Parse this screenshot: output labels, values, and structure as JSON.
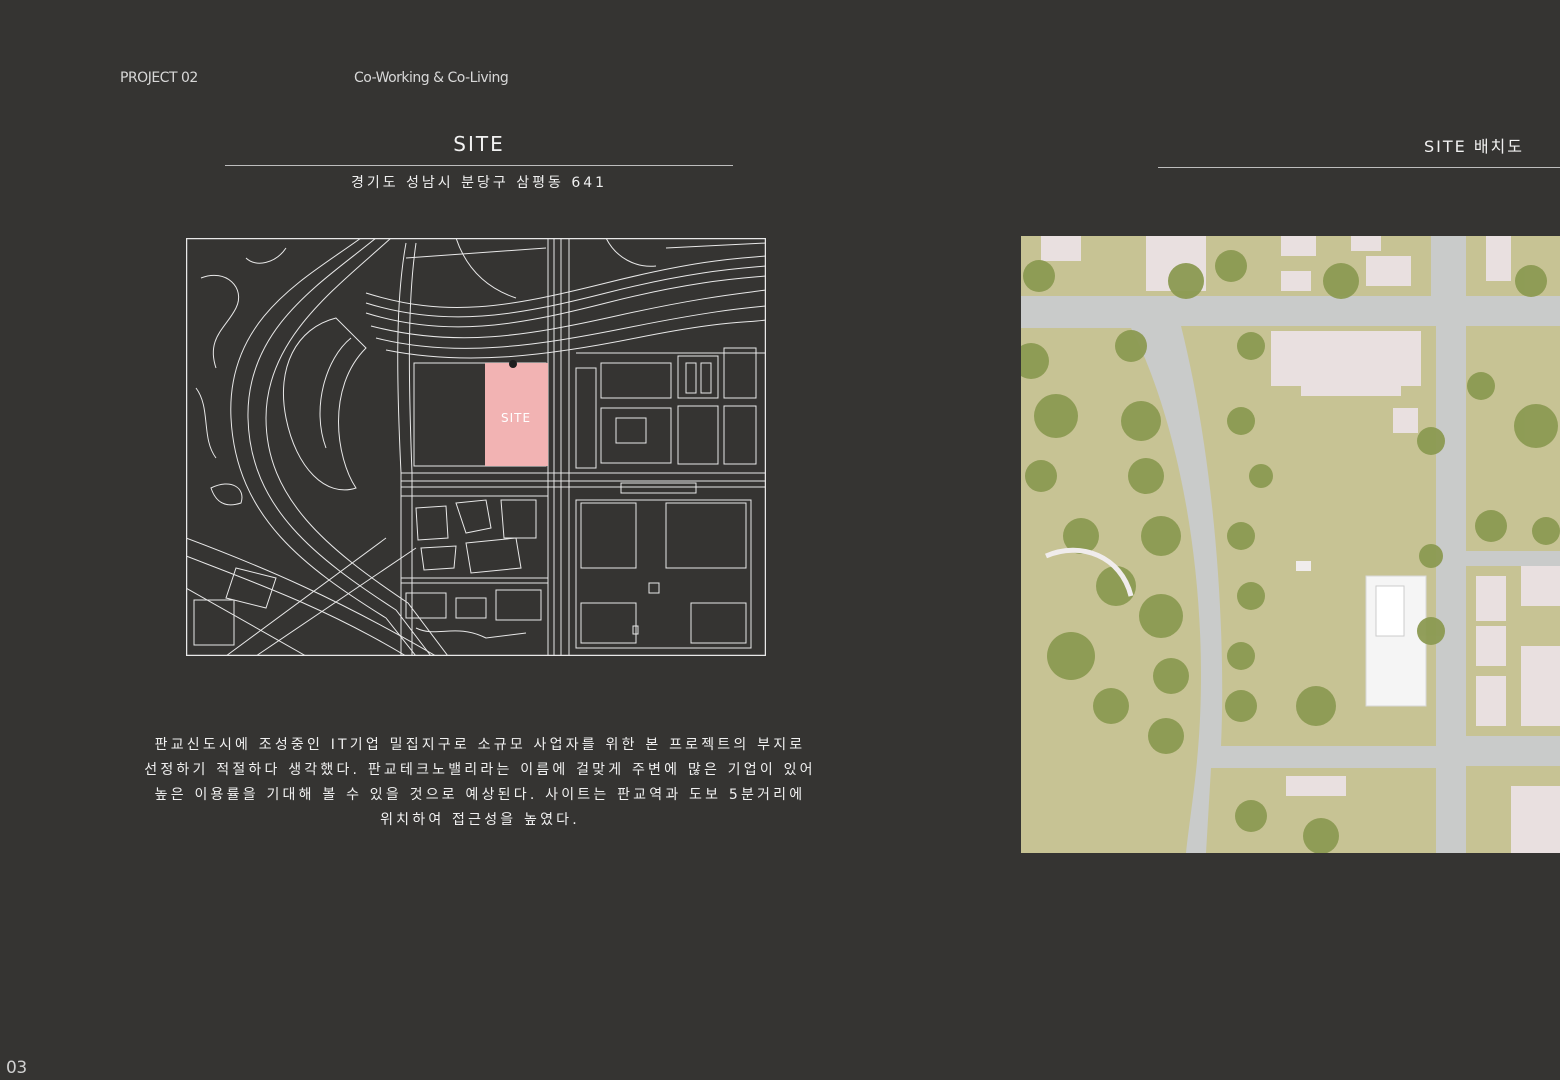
{
  "header": {
    "project": "PROJECT 02",
    "subtitle": "Co-Working & Co-Living"
  },
  "site_section": {
    "title": "SITE",
    "address": "경기도 성남시 분당구 삼평동 641",
    "map_label": "SITE",
    "description_lines": [
      "판교신도시에 조성중인 IT기업 밀집지구로 소규모 사업자를 위한 본 프로젝트의 부지로",
      "선정하기 적절하다 생각했다. 판교테크노밸리라는 이름에 걸맞게 주변에 많은 기업이 있어",
      "높은 이용률을 기대해 볼 수 있을 것으로 예상된다. 사이트는 판교역과 도보 5분거리에",
      "위치하여 접근성을 높였다."
    ]
  },
  "plan_section": {
    "title": "SITE 배치도"
  },
  "page_number": "03",
  "colors": {
    "background": "#353432",
    "site_highlight": "#f2b3b3",
    "map_lines": "#e8e8e8",
    "grass": "#c7c394",
    "road": "#c9cbca",
    "tree": "#8c9a52",
    "building": "#e9e0e0"
  }
}
